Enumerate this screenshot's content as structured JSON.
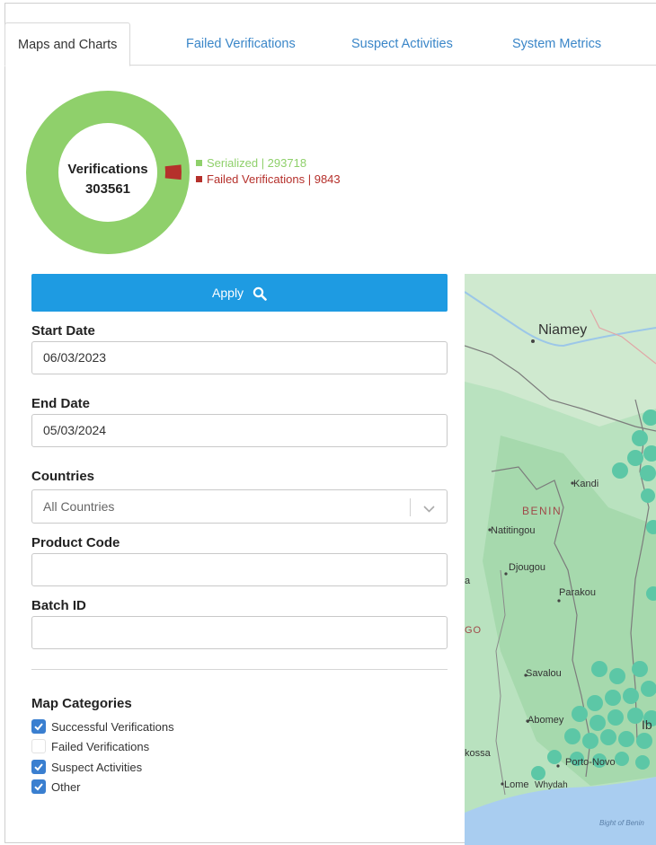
{
  "tabs": [
    {
      "label": "Maps and Charts",
      "active": true
    },
    {
      "label": "Failed Verifications",
      "active": false
    },
    {
      "label": "Suspect Activities",
      "active": false
    },
    {
      "label": "System Metrics",
      "active": false
    }
  ],
  "verifications": {
    "title": "Verifications",
    "total": "303561",
    "legend": [
      {
        "label": "Serialized | 293718",
        "value": 293718,
        "color": "#8fd06b"
      },
      {
        "label": "Failed Verifications | 9843",
        "value": 9843,
        "color": "#b5302b"
      }
    ]
  },
  "filters": {
    "apply_label": "Apply",
    "start_date": {
      "label": "Start Date",
      "value": "06/03/2023"
    },
    "end_date": {
      "label": "End Date",
      "value": "05/03/2024"
    },
    "countries": {
      "label": "Countries",
      "value": "All Countries"
    },
    "product_code": {
      "label": "Product Code",
      "value": ""
    },
    "batch_id": {
      "label": "Batch ID",
      "value": ""
    }
  },
  "map_categories": {
    "title": "Map Categories",
    "items": [
      {
        "label": "Successful Verifications",
        "checked": true
      },
      {
        "label": "Failed Verifications",
        "checked": false
      },
      {
        "label": "Suspect Activities",
        "checked": true
      },
      {
        "label": "Other",
        "checked": true
      }
    ]
  },
  "map": {
    "labels": {
      "niamey": "Niamey",
      "kandi": "Kandi",
      "benin": "BENIN",
      "natitingou": "Natitingou",
      "djougou": "Djougou",
      "parakou": "Parakou",
      "a": "a",
      "go": "GO",
      "savalou": "Savalou",
      "abomey": "Abomey",
      "ib": "Ib",
      "kossa": "kossa",
      "porto_novo": "Porto-Novo",
      "lome": "Lome",
      "whydah": "Whydah",
      "bight": "Bight of Benin"
    },
    "colors": {
      "land": "#9fd3a8",
      "water": "#a9cdf0",
      "marker": "#5cc7a6"
    }
  }
}
